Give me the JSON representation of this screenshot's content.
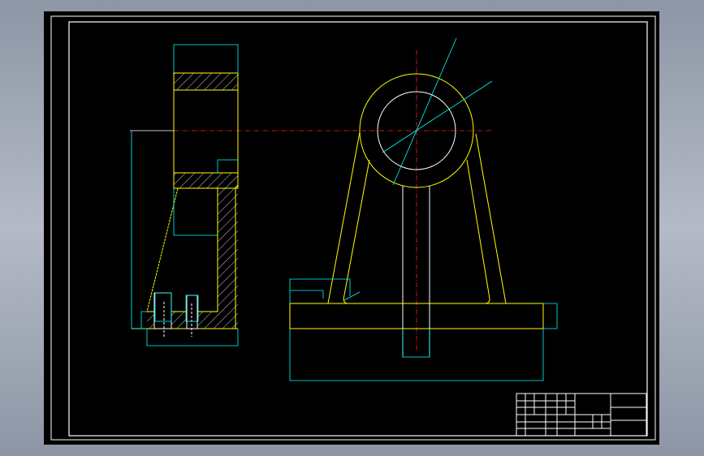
{
  "colors": {
    "background": "#000000",
    "outline": "#ffff00",
    "dimension": "#00ffff",
    "centerline": "#ff0000",
    "frame": "#ffffff",
    "window": "#a4acb9"
  },
  "views": [
    "side-section-view",
    "front-view"
  ],
  "title_block": {
    "present": true
  }
}
